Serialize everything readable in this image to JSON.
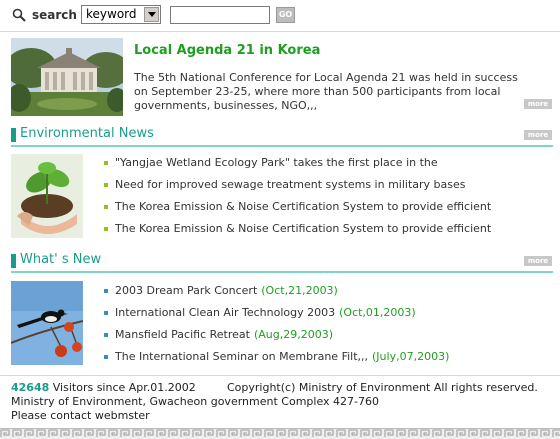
{
  "search": {
    "label": "search",
    "select_value": "keyword",
    "go_label": "GO"
  },
  "feature": {
    "title": "Local Agenda 21 in Korea",
    "body": "The 5th National Conference for Local Agenda 21 was held in success on September 23-25, where more than 500 participants from local governments, businesses, NGO,,,",
    "more": "more"
  },
  "environmental_news": {
    "title": "Environmental News",
    "more": "more",
    "items": [
      "\"Yangjae Wetland Ecology Park\" takes the first place in the",
      " Need for improved sewage treatment systems in military bases",
      "The Korea Emission & Noise Certification System to provide efficient",
      "The Korea Emission & Noise Certification System to provide efficient"
    ]
  },
  "whats_new": {
    "title": "What' s New",
    "more": "more",
    "items": [
      {
        "title": "2003 Dream Park Concert",
        "date": "(Oct,21,2003)"
      },
      {
        "title": "International Clean Air Technology 2003",
        "date": "(Oct,01,2003)"
      },
      {
        "title": "Mansfield Pacific Retreat",
        "date": "(Aug,29,2003)"
      },
      {
        "title": "The International Seminar on Membrane Filt,,,",
        "date": "(July,07,2003)"
      }
    ]
  },
  "footer": {
    "visitor_count": "42648",
    "visitors_text": " Visitors since Apr.01.2002",
    "copyright": "Copyright(c) Ministry of Environment All rights reserved.",
    "address": "Ministry of Environment, Gwacheon government Complex 427-760",
    "contact": "Please contact webmster"
  },
  "colors": {
    "accent_green": "#1f9f20",
    "section_teal": "#1a9c8c",
    "more_gray": "#c8c8c8"
  }
}
